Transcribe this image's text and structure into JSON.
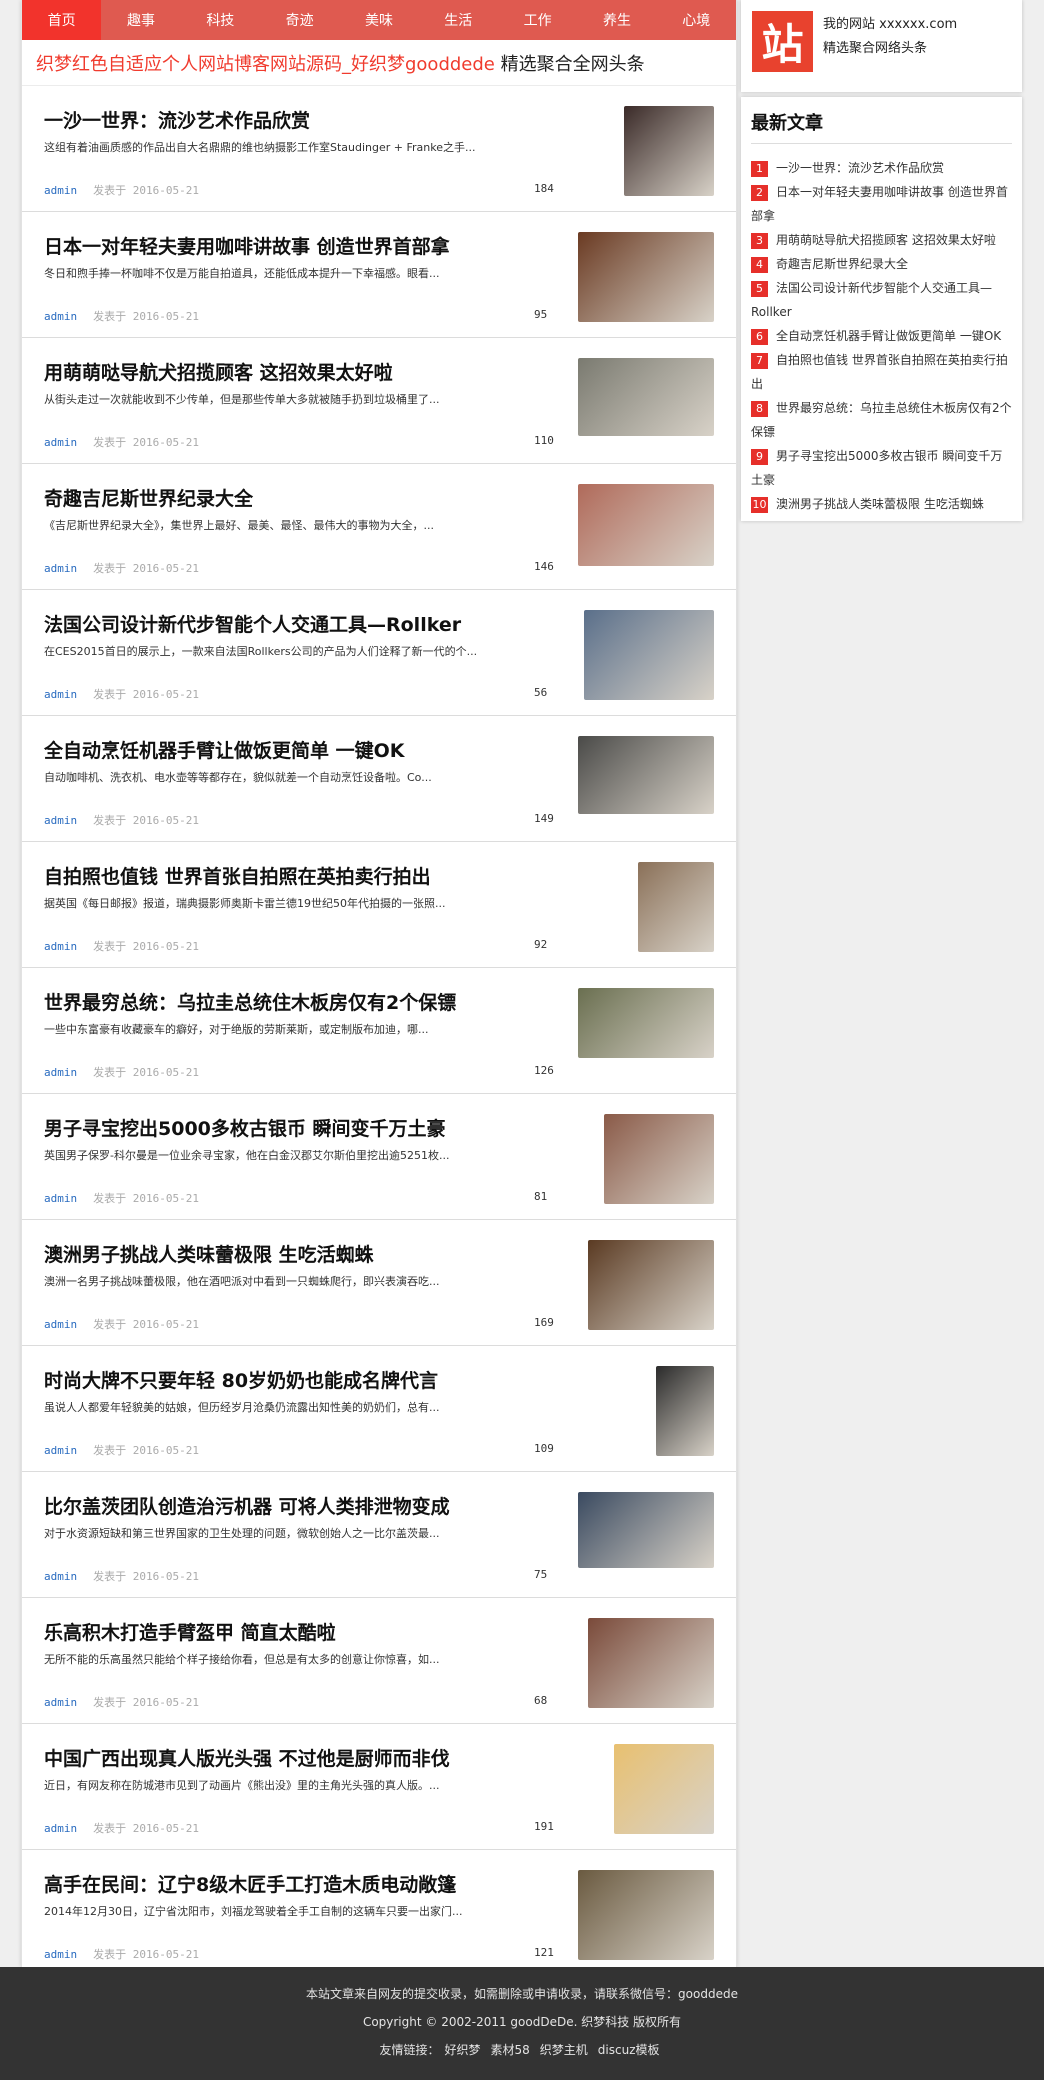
{
  "nav": {
    "items": [
      "首页",
      "趣事",
      "科技",
      "奇迹",
      "美味",
      "生活",
      "工作",
      "养生",
      "心境"
    ]
  },
  "headline": {
    "red_part": "织梦红色自适应个人网站博客网站源码_好织梦gooddede",
    "dark_part": " 精选聚合全网头条"
  },
  "site": {
    "logo_char": "站",
    "name": "我的网站 xxxxxx.com",
    "tagline": "精选聚合网络头条"
  },
  "latest": {
    "heading": "最新文章",
    "items": [
      {
        "num": "1",
        "text": "一沙一世界：流沙艺术作品欣赏"
      },
      {
        "num": "2",
        "text": "日本一对年轻夫妻用咖啡讲故事 创造世界首部拿"
      },
      {
        "num": "3",
        "text": "用萌萌哒导航犬招揽顾客 这招效果太好啦"
      },
      {
        "num": "4",
        "text": "奇趣吉尼斯世界纪录大全"
      },
      {
        "num": "5",
        "text": "法国公司设计新代步智能个人交通工具—Rollker"
      },
      {
        "num": "6",
        "text": "全自动烹饪机器手臂让做饭更简单 一键OK"
      },
      {
        "num": "7",
        "text": "自拍照也值钱 世界首张自拍照在英拍卖行拍出"
      },
      {
        "num": "8",
        "text": "世界最穷总统：乌拉圭总统住木板房仅有2个保镖"
      },
      {
        "num": "9",
        "text": "男子寻宝挖出5000多枚古银币 瞬间变千万土豪"
      },
      {
        "num": "10",
        "text": "澳洲男子挑战人类味蕾极限 生吃活蜘蛛"
      }
    ]
  },
  "articles": [
    {
      "title": "一沙一世界：流沙艺术作品欣赏",
      "summary": "这组有着油画质感的作品出自大名鼎鼎的维也纳摄影工作室Staudinger + Franke之手...",
      "author": "admin",
      "date": "发表于 2016-05-21",
      "views": "184",
      "thumb_color": "#3a2a28",
      "thumb_w": 90,
      "thumb_h": 90
    },
    {
      "title": "日本一对年轻夫妻用咖啡讲故事 创造世界首部拿",
      "summary": "冬日和煦手捧一杯咖啡不仅是万能自拍道具，还能低成本提升一下幸福感。眼看...",
      "author": "admin",
      "date": "发表于 2016-05-21",
      "views": "95",
      "thumb_color": "#6a3a22",
      "thumb_w": 136,
      "thumb_h": 90
    },
    {
      "title": "用萌萌哒导航犬招揽顾客 这招效果太好啦",
      "summary": "从街头走过一次就能收到不少传单，但是那些传单大多就被随手扔到垃圾桶里了...",
      "author": "admin",
      "date": "发表于 2016-05-21",
      "views": "110",
      "thumb_color": "#7a7a70",
      "thumb_w": 136,
      "thumb_h": 78
    },
    {
      "title": "奇趣吉尼斯世界纪录大全",
      "summary": "《吉尼斯世界纪录大全》，集世界上最好、最美、最怪、最伟大的事物为大全，...",
      "author": "admin",
      "date": "发表于 2016-05-21",
      "views": "146",
      "thumb_color": "#b06a5a",
      "thumb_w": 136,
      "thumb_h": 82
    },
    {
      "title": "法国公司设计新代步智能个人交通工具—Rollker",
      "summary": "在CES2015首日的展示上，一款来自法国Rollkers公司的产品为人们诠释了新一代的个...",
      "author": "admin",
      "date": "发表于 2016-05-21",
      "views": "56",
      "thumb_color": "#5a6f8a",
      "thumb_w": 130,
      "thumb_h": 90
    },
    {
      "title": "全自动烹饪机器手臂让做饭更简单 一键OK",
      "summary": "自动咖啡机、洗衣机、电水壶等等都存在，貌似就差一个自动烹饪设备啦。Co...",
      "author": "admin",
      "date": "发表于 2016-05-21",
      "views": "149",
      "thumb_color": "#4a4a48",
      "thumb_w": 136,
      "thumb_h": 78
    },
    {
      "title": "自拍照也值钱 世界首张自拍照在英拍卖行拍出",
      "summary": "据英国《每日邮报》报道，瑞典摄影师奥斯卡雷兰德19世纪50年代拍摄的一张照...",
      "author": "admin",
      "date": "发表于 2016-05-21",
      "views": "92",
      "thumb_color": "#8a7058",
      "thumb_w": 76,
      "thumb_h": 90
    },
    {
      "title": "世界最穷总统：乌拉圭总统住木板房仅有2个保镖",
      "summary": "一些中东富豪有收藏豪车的癖好，对于绝版的劳斯莱斯，或定制版布加迪，哪...",
      "author": "admin",
      "date": "发表于 2016-05-21",
      "views": "126",
      "thumb_color": "#6a6f50",
      "thumb_w": 136,
      "thumb_h": 70
    },
    {
      "title": "男子寻宝挖出5000多枚古银币 瞬间变千万土豪",
      "summary": "英国男子保罗-科尔曼是一位业余寻宝家，他在白金汉郡艾尔斯伯里挖出逾5251枚...",
      "author": "admin",
      "date": "发表于 2016-05-21",
      "views": "81",
      "thumb_color": "#8a5a48",
      "thumb_w": 110,
      "thumb_h": 90
    },
    {
      "title": "澳洲男子挑战人类味蕾极限 生吃活蜘蛛",
      "summary": "澳洲一名男子挑战味蕾极限，他在酒吧派对中看到一只蜘蛛爬行，即兴表演吞吃...",
      "author": "admin",
      "date": "发表于 2016-05-21",
      "views": "169",
      "thumb_color": "#5a3a22",
      "thumb_w": 126,
      "thumb_h": 90
    },
    {
      "title": "时尚大牌不只要年轻 80岁奶奶也能成名牌代言",
      "summary": "虽说人人都爱年轻貌美的姑娘，但历经岁月沧桑仍流露出知性美的奶奶们，总有...",
      "author": "admin",
      "date": "发表于 2016-05-21",
      "views": "109",
      "thumb_color": "#2a2a2a",
      "thumb_w": 58,
      "thumb_h": 90
    },
    {
      "title": "比尔盖茨团队创造治污机器 可将人类排泄物变成",
      "summary": "对于水资源短缺和第三世界国家的卫生处理的问题，微软创始人之一比尔盖茨最...",
      "author": "admin",
      "date": "发表于 2016-05-21",
      "views": "75",
      "thumb_color": "#3a4a60",
      "thumb_w": 136,
      "thumb_h": 76
    },
    {
      "title": "乐高积木打造手臂盔甲 简直太酷啦",
      "summary": "无所不能的乐高虽然只能给个样子接给你看，但总是有太多的创意让你惊喜，如...",
      "author": "admin",
      "date": "发表于 2016-05-21",
      "views": "68",
      "thumb_color": "#7a4a3a",
      "thumb_w": 126,
      "thumb_h": 90
    },
    {
      "title": "中国广西出现真人版光头强 不过他是厨师而非伐",
      "summary": "近日，有网友称在防城港市见到了动画片《熊出没》里的主角光头强的真人版。...",
      "author": "admin",
      "date": "发表于 2016-05-21",
      "views": "191",
      "thumb_color": "#e8c070",
      "thumb_w": 100,
      "thumb_h": 90
    },
    {
      "title": "高手在民间：辽宁8级木匠手工打造木质电动敞篷",
      "summary": "2014年12月30日，辽宁省沈阳市，刘福龙驾驶着全手工自制的这辆车只要一出家门...",
      "author": "admin",
      "date": "发表于 2016-05-21",
      "views": "121",
      "thumb_color": "#6a5a40",
      "thumb_w": 136,
      "thumb_h": 90
    }
  ],
  "footer": {
    "line1": "本站文章来自网友的提交收录，如需删除或申请收录，请联系微信号：gooddede",
    "line2": "Copyright © 2002-2011 goodDeDe. 织梦科技 版权所有",
    "links_label": "友情链接：",
    "links": [
      "好织梦",
      "素材58",
      "织梦主机",
      "discuz模板"
    ]
  }
}
